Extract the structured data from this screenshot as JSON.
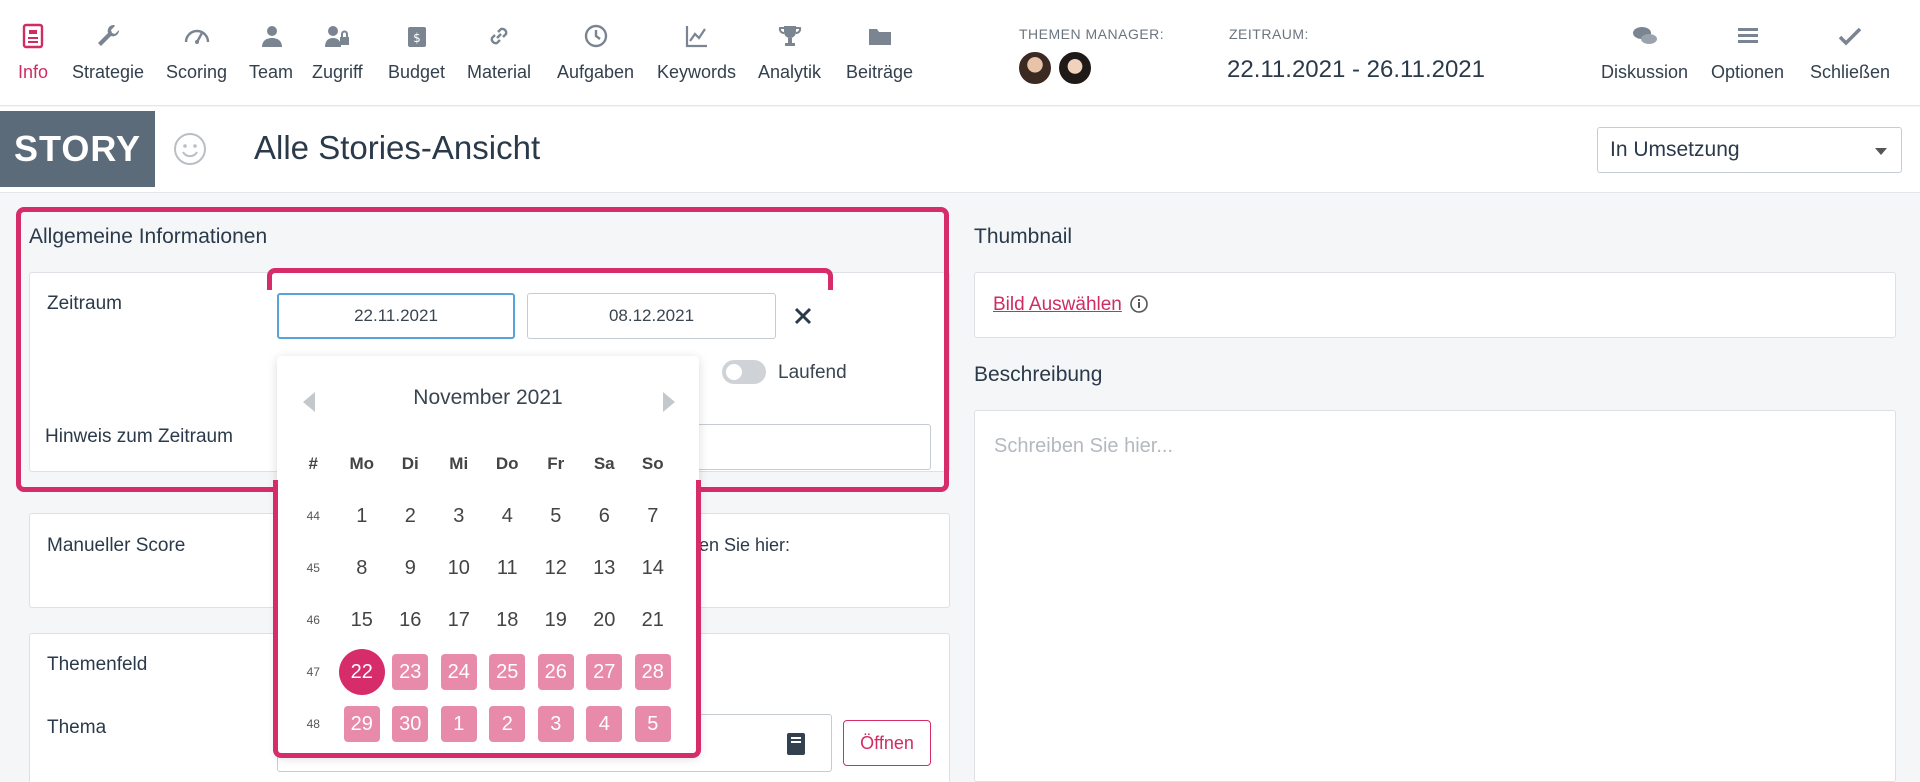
{
  "nav": {
    "items": [
      {
        "label": "Info",
        "icon": "info-icon"
      },
      {
        "label": "Strategie",
        "icon": "wrench-icon"
      },
      {
        "label": "Scoring",
        "icon": "gauge-icon"
      },
      {
        "label": "Team",
        "icon": "team-icon"
      },
      {
        "label": "Zugriff",
        "icon": "access-icon"
      },
      {
        "label": "Budget",
        "icon": "budget-icon"
      },
      {
        "label": "Material",
        "icon": "link-icon"
      },
      {
        "label": "Aufgaben",
        "icon": "clock-icon"
      },
      {
        "label": "Keywords",
        "icon": "chart-icon"
      },
      {
        "label": "Analytik",
        "icon": "trophy-icon"
      },
      {
        "label": "Beiträge",
        "icon": "folder-icon"
      }
    ],
    "right": [
      {
        "label": "Diskussion",
        "icon": "chat-icon"
      },
      {
        "label": "Optionen",
        "icon": "menu-icon"
      },
      {
        "label": "Schließen",
        "icon": "check-icon"
      }
    ],
    "manager_label": "THEMEN MANAGER:",
    "zeitraum_label": "ZEITRAUM:",
    "zeitraum_value": "22.11.2021 - 26.11.2021"
  },
  "story": {
    "badge": "STORY",
    "title": "Alle Stories-Ansicht",
    "status": "In Umsetzung"
  },
  "general": {
    "title": "Allgemeine Informationen",
    "zeitraum_label": "Zeitraum",
    "start_date": "22.11.2021",
    "end_date": "08.12.2021",
    "ongoing_label": "Laufend",
    "hint_label": "Hinweis zum Zeitraum",
    "score_label": "Manueller Score",
    "score_hint": "en Sie hier:",
    "themenfeld_label": "Themenfeld",
    "thema_label": "Thema",
    "open_button": "Öffnen"
  },
  "calendar": {
    "month": "November 2021",
    "headers": [
      "#",
      "Mo",
      "Di",
      "Mi",
      "Do",
      "Fr",
      "Sa",
      "So"
    ],
    "weeks": [
      {
        "wk": "44",
        "days": [
          "1",
          "2",
          "3",
          "4",
          "5",
          "6",
          "7"
        ]
      },
      {
        "wk": "45",
        "days": [
          "8",
          "9",
          "10",
          "11",
          "12",
          "13",
          "14"
        ]
      },
      {
        "wk": "46",
        "days": [
          "15",
          "16",
          "17",
          "18",
          "19",
          "20",
          "21"
        ]
      },
      {
        "wk": "47",
        "days": [
          "22",
          "23",
          "24",
          "25",
          "26",
          "27",
          "28"
        ]
      },
      {
        "wk": "48",
        "days": [
          "29",
          "30",
          "1",
          "2",
          "3",
          "4",
          "5"
        ]
      }
    ]
  },
  "thumbnail": {
    "title": "Thumbnail",
    "link": "Bild Auswählen"
  },
  "description": {
    "title": "Beschreibung",
    "placeholder": "Schreiben Sie hier..."
  },
  "colors": {
    "accent": "#d62d6a",
    "range": "#e88aaa",
    "badge": "#5c6b7a"
  }
}
